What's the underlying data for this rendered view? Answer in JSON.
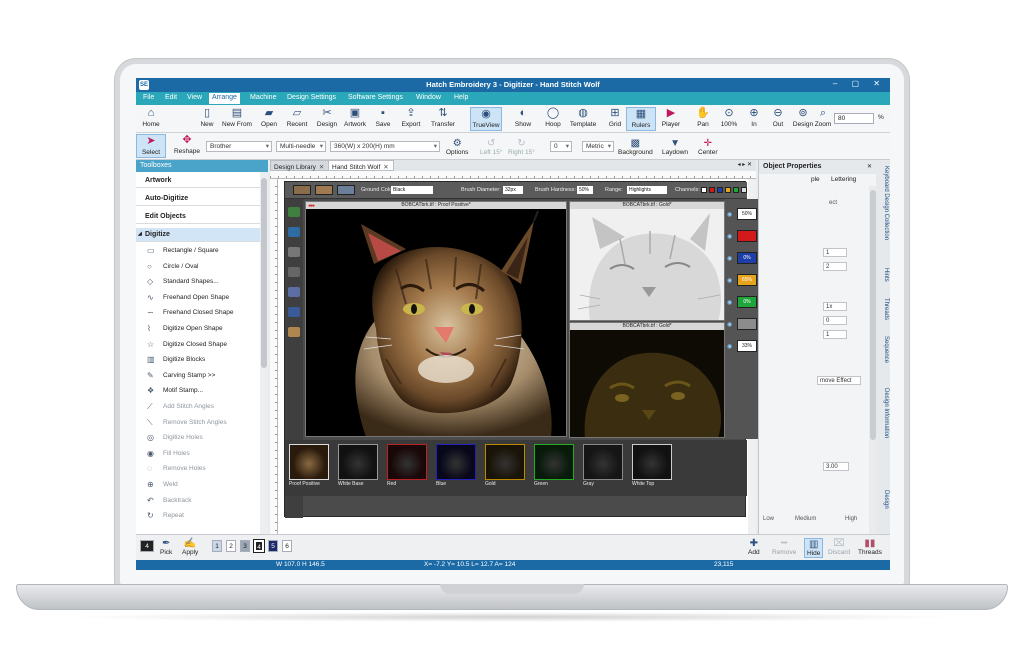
{
  "window": {
    "app_icon": "SE",
    "title": "Hatch Embroidery 3 - Digitizer - Hand Stitch Wolf",
    "controls": "– ▢ ✕"
  },
  "menu": [
    "File",
    "Edit",
    "View",
    "Arrange",
    "Machine",
    "Design Settings",
    "Software Settings",
    "Window",
    "Help"
  ],
  "ribbon1": {
    "home": "Home",
    "new": "New",
    "new_from": "New From",
    "open": "Open",
    "recent": "Recent",
    "design": "Design",
    "artwork": "Artwork",
    "save": "Save",
    "export": "Export",
    "transfer": "Transfer",
    "trueview": "TrueView",
    "show": "Show",
    "hoop": "Hoop",
    "template": "Template",
    "grid": "Grid",
    "rulers": "Rulers",
    "player": "Player",
    "pan": "Pan",
    "zoom100": "100%",
    "zoom_in": "In",
    "zoom_out": "Out",
    "zoom_design": "Design",
    "zoom": "Zoom",
    "zoom_value": "80",
    "zoom_unit": "%"
  },
  "ribbon2": {
    "select": "Select",
    "reshape": "Reshape",
    "brand": "Brother",
    "needle": "Multi-needle",
    "hoop_size": "360(W) x 200(H) mm",
    "options": "Options",
    "left": "Left 15°",
    "right": "Right 15°",
    "angle": "0",
    "units": "Metric",
    "background": "Background",
    "laydown": "Laydown",
    "center": "Center"
  },
  "toolbox": {
    "title": "Toolboxes",
    "sections": [
      "Artwork",
      "Auto-Digitize",
      "Edit Objects",
      "Digitize"
    ],
    "items": [
      {
        "label": "Rectangle / Square",
        "icon": "▭",
        "dim": false
      },
      {
        "label": "Circle / Oval",
        "icon": "○",
        "dim": false
      },
      {
        "label": "Standard Shapes...",
        "icon": "◇",
        "dim": false
      },
      {
        "label": "Freehand Open Shape",
        "icon": "∿",
        "dim": false
      },
      {
        "label": "Freehand Closed Shape",
        "icon": "∽",
        "dim": false
      },
      {
        "label": "Digitize Open Shape",
        "icon": "⌇",
        "dim": false
      },
      {
        "label": "Digitize Closed Shape",
        "icon": "☆",
        "dim": false
      },
      {
        "label": "Digitize Blocks",
        "icon": "▥",
        "dim": false
      },
      {
        "label": "Carving Stamp >>",
        "icon": "✎",
        "dim": false
      },
      {
        "label": "Motif Stamp...",
        "icon": "❖",
        "dim": false
      },
      {
        "label": "Add Stitch Angles",
        "icon": "⟋",
        "dim": true
      },
      {
        "label": "Remove Stitch Angles",
        "icon": "⟍",
        "dim": true
      },
      {
        "label": "Digitize Holes",
        "icon": "◎",
        "dim": true
      },
      {
        "label": "Fill Holes",
        "icon": "◉",
        "dim": true
      },
      {
        "label": "Remove Holes",
        "icon": "◌",
        "dim": true
      },
      {
        "label": "Weld",
        "icon": "⊕",
        "dim": true
      },
      {
        "label": "Backtrack",
        "icon": "↶",
        "dim": true
      },
      {
        "label": "Repeat",
        "icon": "↻",
        "dim": true
      }
    ]
  },
  "doctabs": [
    "Design Library",
    "Hand Stitch Wolf"
  ],
  "photoshop": {
    "ground_color_label": "Ground Color:",
    "ground_color": "Black",
    "brush_diameter_label": "Brush Diameter:",
    "brush_diameter": "32px",
    "brush_hardness_label": "Brush Hardness:",
    "brush_hardness": "50%",
    "range_label": "Range:",
    "range": "Highlights",
    "channels_label": "Channels:",
    "win_main": "BOBCATbrk.tif : Proof Positive*",
    "win_top": "BOBCATbrk.tif : Gold*",
    "win_bottom": "BOBCATbrk.tif : Gold*",
    "channels": [
      {
        "pct": "50%",
        "name": "White Base",
        "color": "#ffffff",
        "text": "#222222"
      },
      {
        "pct": "",
        "name": "Red",
        "color": "#d21a1a",
        "text": "#ffffff"
      },
      {
        "pct": "0%",
        "name": "Blue",
        "color": "#1f3fa8",
        "text": "#ffffff"
      },
      {
        "pct": "65%",
        "name": "Gold",
        "color": "#e6a31c",
        "text": "#ffffff"
      },
      {
        "pct": "0%",
        "name": "Green",
        "color": "#1fa63a",
        "text": "#ffffff"
      },
      {
        "pct": "",
        "name": "Gray",
        "color": "#8c8c8c",
        "text": "#ffffff"
      },
      {
        "pct": "33%",
        "name": "White Top",
        "color": "#ffffff",
        "text": "#222222"
      }
    ],
    "thumbs": [
      "Proof Positive",
      "White Base",
      "Red",
      "Blue",
      "Gold",
      "Green",
      "Gray",
      "White Top"
    ]
  },
  "rpanel": {
    "title": "Object Properties",
    "tab1": "ple",
    "tab2": "Lettering",
    "select_text": "ect",
    "v1": "1",
    "v2": "2",
    "v3": "1x",
    "v4": "0",
    "v5": "1",
    "effect": "move Effect",
    "v6": "3.00",
    "low": "Low",
    "medium": "Medium",
    "high": "High"
  },
  "vtabs": [
    "Keyboard Design Collection",
    "Hints",
    "Threads",
    "Sequence",
    "Design Information",
    "Design"
  ],
  "bottombar": {
    "left_num": "4",
    "pick": "Pick",
    "apply": "Apply",
    "nums": [
      "1",
      "2",
      "3",
      "4",
      "5",
      "6"
    ],
    "add": "Add",
    "remove": "Remove",
    "hide": "Hide",
    "discard": "Discard",
    "threads": "Threads"
  },
  "status": {
    "size": "W 107.0 H 146.5",
    "coords": "X= -7.2 Y= 10.5 L= 12.7 A= 124",
    "count": "23,115"
  }
}
